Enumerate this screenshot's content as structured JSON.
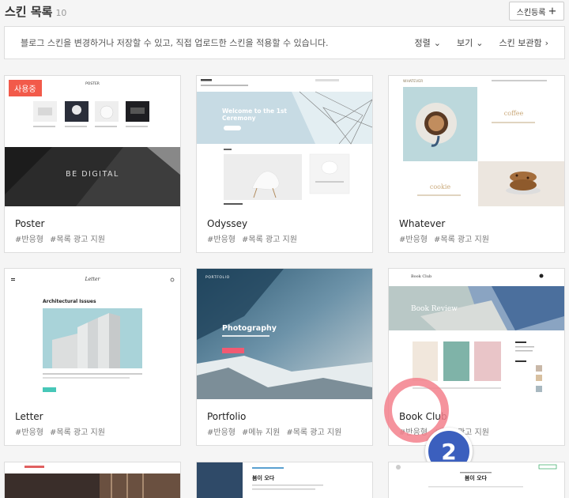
{
  "header": {
    "title": "스킨 목록",
    "count": "10",
    "register_label": "스킨등록"
  },
  "infobar": {
    "description": "블로그 스킨을 변경하거나 저장할 수 있고, 직접 업로드한 스킨을 적용할 수 있습니다.",
    "sort_label": "정렬",
    "view_label": "보기",
    "storage_label": "스킨 보관함"
  },
  "cards": [
    {
      "name": "Poster",
      "tags": [
        "#반응형",
        "#목록 광고 지원"
      ],
      "badge": "사용중"
    },
    {
      "name": "Odyssey",
      "tags": [
        "#반응형",
        "#목록 광고 지원"
      ]
    },
    {
      "name": "Whatever",
      "tags": [
        "#반응형",
        "#목록 광고 지원"
      ]
    },
    {
      "name": "Letter",
      "tags": [
        "#반응형",
        "#목록 광고 지원"
      ]
    },
    {
      "name": "Portfolio",
      "tags": [
        "#반응형",
        "#메뉴 지원",
        "#목록 광고 지원"
      ]
    },
    {
      "name": "Book Club",
      "tags": [
        "#반응형",
        "#목록 광고 지원"
      ]
    }
  ],
  "thumbs": {
    "poster": {
      "brand": "POSTER",
      "hero": "BE DIGITAL"
    },
    "odyssey": {
      "hero": "Welcome to the 1st Ceremony"
    },
    "whatever": {
      "brand": "WHATEVER",
      "coffee": "coffee",
      "cookie": "cookie"
    },
    "letter": {
      "brand": "Letter",
      "heading": "Architectural Issues"
    },
    "portfolio": {
      "brand": "PORTFOLIO",
      "hero": "Photography"
    },
    "bookclub": {
      "brand": "Book Club",
      "hero": "Book Review"
    },
    "bottom2": {
      "text": "봄이 오다"
    },
    "bottom3": {
      "text": "봄이 오다"
    }
  },
  "annotation": {
    "number": "2"
  },
  "colors": {
    "badge": "#f25a4a",
    "accent_blue": "#3b5fbe",
    "ring": "#f3808c"
  }
}
